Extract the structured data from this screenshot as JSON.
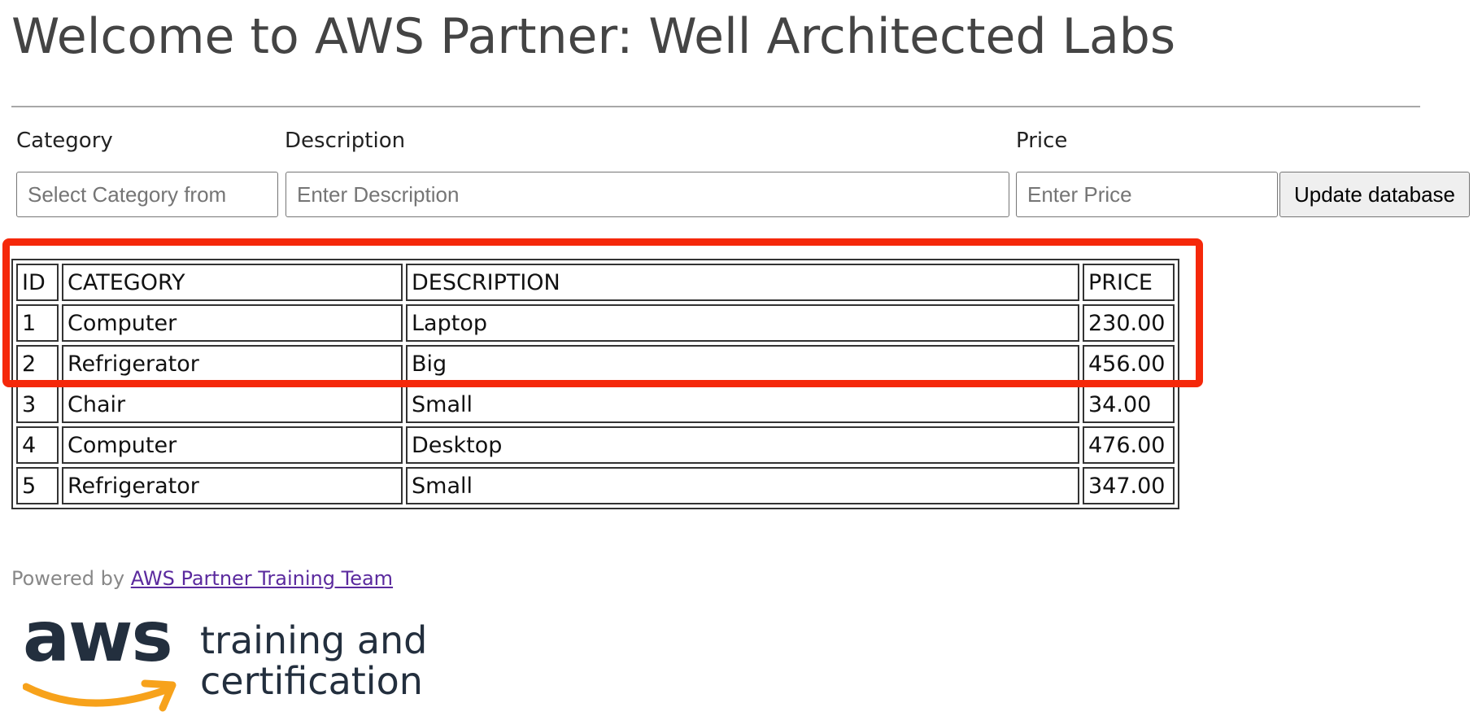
{
  "header": {
    "title": "Welcome to AWS Partner: Well Architected Labs"
  },
  "form": {
    "category_label": "Category",
    "category_placeholder": "Select Category from",
    "category_value": "",
    "description_label": "Description",
    "description_placeholder": "Enter Description",
    "description_value": "",
    "price_label": "Price",
    "price_placeholder": "Enter Price",
    "price_value": "",
    "submit_label": "Update database"
  },
  "table": {
    "headers": [
      "ID",
      "CATEGORY",
      "DESCRIPTION",
      "PRICE"
    ],
    "rows": [
      [
        "1",
        "Computer",
        "Laptop",
        "230.00"
      ],
      [
        "2",
        "Refrigerator",
        "Big",
        "456.00"
      ],
      [
        "3",
        "Chair",
        "Small",
        "34.00"
      ],
      [
        "4",
        "Computer",
        "Desktop",
        "476.00"
      ],
      [
        "5",
        "Refrigerator",
        "Small",
        "347.00"
      ]
    ]
  },
  "annotation": {
    "highlight_color": "#f5280a",
    "highlighted_rows": [
      "header",
      "1",
      "2"
    ]
  },
  "footer": {
    "powered_by": "Powered by",
    "link_text": "AWS Partner Training Team",
    "link_color": "#5b2a9e"
  },
  "logo": {
    "brand": "aws",
    "line1": "training and",
    "line2": "certification",
    "smile_color": "#f7a21b",
    "text_color": "#232f3e"
  }
}
